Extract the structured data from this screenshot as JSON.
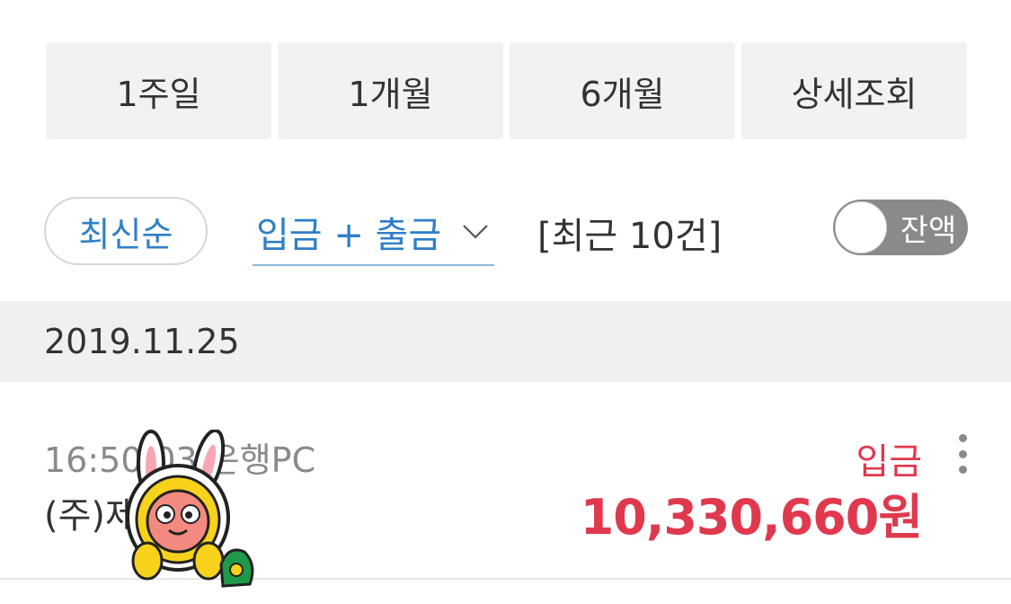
{
  "period_tabs": [
    {
      "label": "1주일"
    },
    {
      "label": "1개월"
    },
    {
      "label": "6개월"
    },
    {
      "label": "상세조회"
    }
  ],
  "filters": {
    "sort_label": "최신순",
    "type_label": "입금 + 출금",
    "recent_count_label": "[최근 10건]",
    "balance_toggle_label": "잔액",
    "balance_toggle_on": false
  },
  "date_header": "2019.11.25",
  "transaction": {
    "time_channel": "16:50:03 은행PC",
    "party": "(주)제",
    "type": "입금",
    "amount": "10,330,660원"
  },
  "colors": {
    "accent_blue": "#2f7fc8",
    "deposit_red": "#e0394e",
    "tab_bg": "#f2f2f2"
  },
  "icons": {
    "dropdown": "chevron-down-icon",
    "more": "more-vertical-icon",
    "sticker": "rabbit-sticker"
  }
}
